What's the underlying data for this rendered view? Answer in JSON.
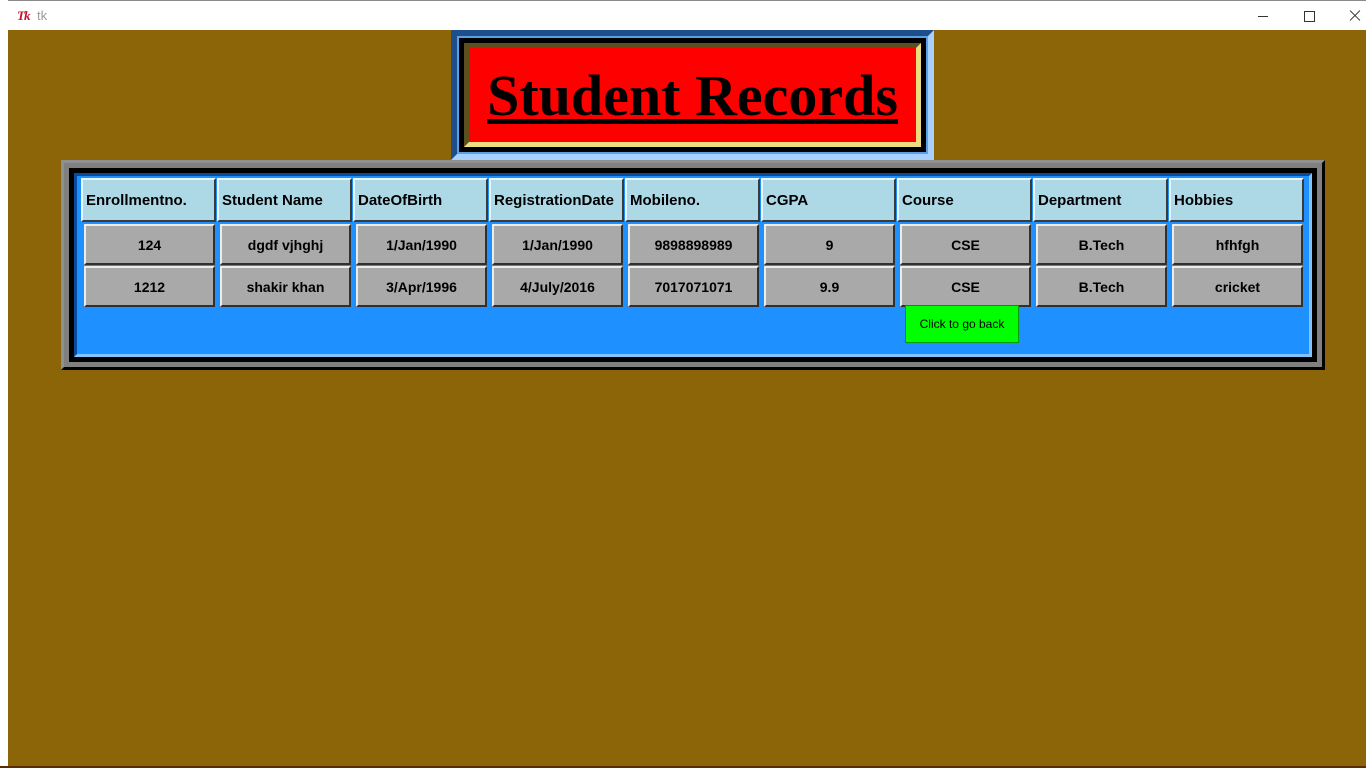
{
  "window": {
    "title": "tk",
    "logo": "Tk"
  },
  "banner": {
    "title": "Student Records"
  },
  "table": {
    "headers": [
      "Enrollmentno.",
      "Student Name",
      "DateOfBirth",
      "RegistrationDate",
      "Mobileno.",
      "CGPA",
      "Course",
      "Department",
      "Hobbies"
    ],
    "rows": [
      [
        "124",
        "dgdf vjhghj",
        "1/Jan/1990",
        "1/Jan/1990",
        "9898898989",
        "9",
        "CSE",
        "B.Tech",
        "hfhfgh"
      ],
      [
        "1212",
        "shakir khan",
        "3/Apr/1996",
        "4/July/2016",
        "7017071071",
        "9.9",
        "CSE",
        "B.Tech",
        "cricket"
      ]
    ]
  },
  "back_button": {
    "label": "Click to go back"
  },
  "colors": {
    "background": "#8b6508",
    "banner_fill": "#ff0000",
    "frame_fill": "#1e90ff",
    "header_fill": "#add8e6",
    "cell_fill": "#a9a9a9",
    "back_button_fill": "#00ff00"
  }
}
